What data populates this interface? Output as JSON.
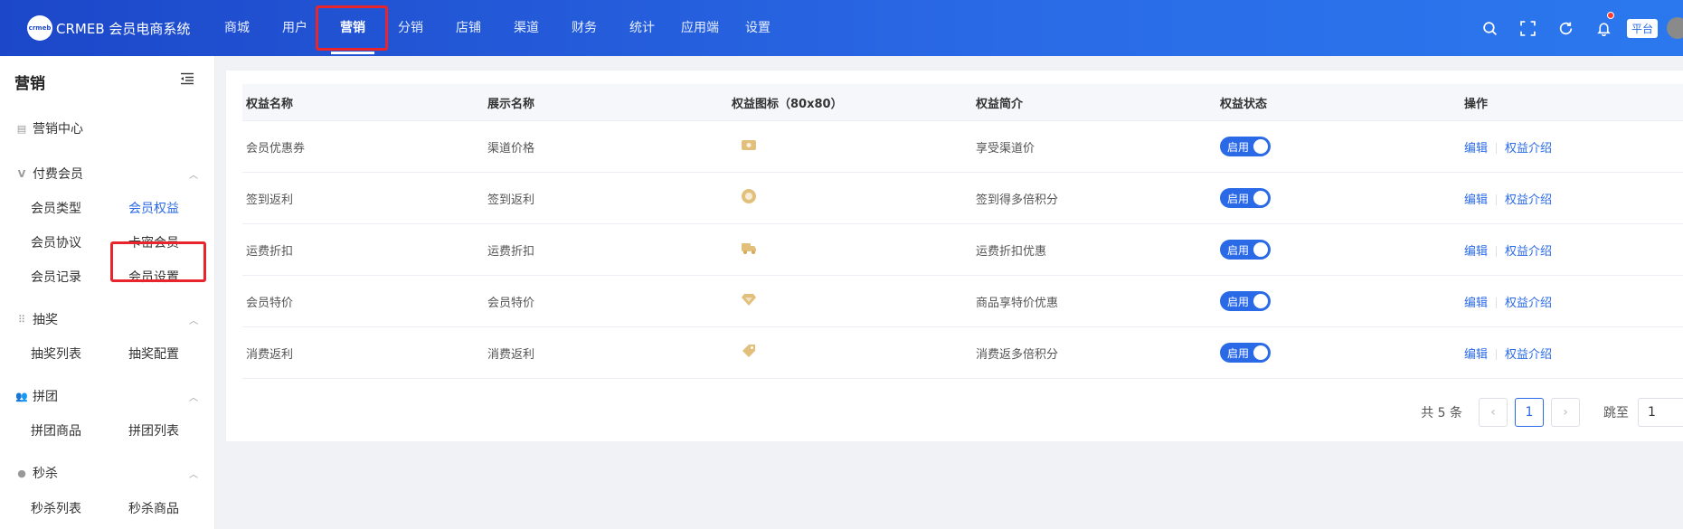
{
  "logo": {
    "mark": "crmeb",
    "text": "CRMEB 会员电商系统"
  },
  "topnav": [
    "商城",
    "用户",
    "营销",
    "分销",
    "店铺",
    "渠道",
    "财务",
    "统计",
    "应用端",
    "设置"
  ],
  "active_nav": "营销",
  "header_tag": "平台",
  "sidebar": {
    "title": "营销",
    "marketing_center": "营销中心",
    "groups": {
      "paid_member": {
        "label": "付费会员",
        "items": [
          "会员类型",
          "会员权益",
          "会员协议",
          "卡密会员",
          "会员记录",
          "会员设置"
        ]
      },
      "lottery": {
        "label": "抽奖",
        "items": [
          "抽奖列表",
          "抽奖配置"
        ]
      },
      "group_buy": {
        "label": "拼团",
        "items": [
          "拼团商品",
          "拼团列表"
        ]
      },
      "seckill": {
        "label": "秒杀",
        "items": [
          "秒杀列表",
          "秒杀商品"
        ]
      }
    }
  },
  "table": {
    "headers": [
      "权益名称",
      "展示名称",
      "权益图标（80x80）",
      "权益简介",
      "权益状态",
      "操作"
    ],
    "rows": [
      {
        "name": "会员优惠券",
        "display": "渠道价格",
        "icon": "coupon-icon",
        "intro": "享受渠道价",
        "status": "启用"
      },
      {
        "name": "签到返利",
        "display": "签到返利",
        "icon": "checkin-coin-icon",
        "intro": "签到得多倍积分",
        "status": "启用"
      },
      {
        "name": "运费折扣",
        "display": "运费折扣",
        "icon": "truck-icon",
        "intro": "运费折扣优惠",
        "status": "启用"
      },
      {
        "name": "会员特价",
        "display": "会员特价",
        "icon": "diamond-icon",
        "intro": "商品享特价优惠",
        "status": "启用"
      },
      {
        "name": "消费返利",
        "display": "消费返利",
        "icon": "tag-icon",
        "intro": "消费返多倍积分",
        "status": "启用"
      }
    ],
    "actions": {
      "edit": "编辑",
      "intro": "权益介绍"
    }
  },
  "pagination": {
    "total": "共 5 条",
    "current": "1",
    "jump_label": "跳至",
    "jump_value": "1"
  },
  "colors": {
    "primary": "#2a6ae6",
    "highlight": "#e8242c",
    "icon_gold": "#e2c07c"
  }
}
